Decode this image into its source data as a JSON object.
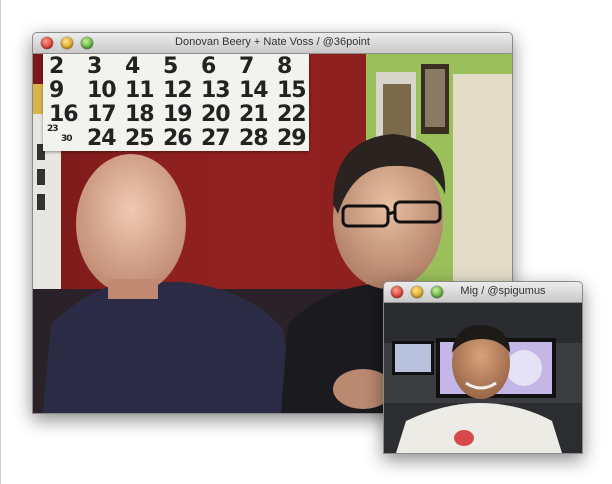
{
  "main_window": {
    "title": "Donovan Beery + Nate Voss / @36point"
  },
  "pip_window": {
    "title": "Mig / @spigumus"
  },
  "calendar": {
    "rows": [
      [
        "2",
        "3",
        "4",
        "5",
        "6",
        "7",
        "8"
      ],
      [
        "9",
        "10",
        "11",
        "12",
        "13",
        "14",
        "15"
      ],
      [
        "16",
        "17",
        "18",
        "19",
        "20",
        "21",
        "22"
      ],
      [
        "30",
        "24",
        "25",
        "26",
        "27",
        "28",
        "29"
      ]
    ],
    "small_23": "23"
  },
  "colors": {
    "wall_red": "#8e1f1f",
    "wall_green": "#9bbf5a",
    "close": "#d8352a",
    "minimize": "#d9a019",
    "zoom": "#54a934"
  }
}
